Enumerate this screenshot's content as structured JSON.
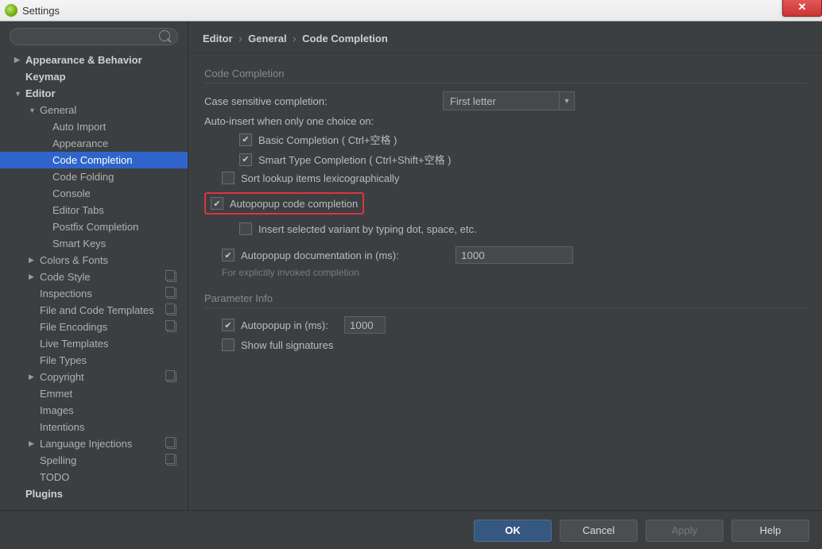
{
  "window": {
    "title": "Settings"
  },
  "search": {
    "placeholder": ""
  },
  "sidebar": {
    "items": [
      {
        "label": "Appearance & Behavior",
        "level": 0,
        "bold": true,
        "arrow": "▶"
      },
      {
        "label": "Keymap",
        "level": 0,
        "bold": true,
        "arrow": ""
      },
      {
        "label": "Editor",
        "level": 0,
        "bold": true,
        "arrow": "▼"
      },
      {
        "label": "General",
        "level": 1,
        "bold": false,
        "arrow": "▼"
      },
      {
        "label": "Auto Import",
        "level": 2,
        "bold": false,
        "arrow": ""
      },
      {
        "label": "Appearance",
        "level": 2,
        "bold": false,
        "arrow": ""
      },
      {
        "label": "Code Completion",
        "level": 2,
        "bold": false,
        "arrow": "",
        "selected": true
      },
      {
        "label": "Code Folding",
        "level": 2,
        "bold": false,
        "arrow": ""
      },
      {
        "label": "Console",
        "level": 2,
        "bold": false,
        "arrow": ""
      },
      {
        "label": "Editor Tabs",
        "level": 2,
        "bold": false,
        "arrow": ""
      },
      {
        "label": "Postfix Completion",
        "level": 2,
        "bold": false,
        "arrow": ""
      },
      {
        "label": "Smart Keys",
        "level": 2,
        "bold": false,
        "arrow": ""
      },
      {
        "label": "Colors & Fonts",
        "level": 1,
        "bold": false,
        "arrow": "▶"
      },
      {
        "label": "Code Style",
        "level": 1,
        "bold": false,
        "arrow": "▶",
        "copy": true
      },
      {
        "label": "Inspections",
        "level": 1,
        "bold": false,
        "arrow": "",
        "copy": true
      },
      {
        "label": "File and Code Templates",
        "level": 1,
        "bold": false,
        "arrow": "",
        "copy": true
      },
      {
        "label": "File Encodings",
        "level": 1,
        "bold": false,
        "arrow": "",
        "copy": true
      },
      {
        "label": "Live Templates",
        "level": 1,
        "bold": false,
        "arrow": ""
      },
      {
        "label": "File Types",
        "level": 1,
        "bold": false,
        "arrow": ""
      },
      {
        "label": "Copyright",
        "level": 1,
        "bold": false,
        "arrow": "▶",
        "copy": true
      },
      {
        "label": "Emmet",
        "level": 1,
        "bold": false,
        "arrow": ""
      },
      {
        "label": "Images",
        "level": 1,
        "bold": false,
        "arrow": ""
      },
      {
        "label": "Intentions",
        "level": 1,
        "bold": false,
        "arrow": ""
      },
      {
        "label": "Language Injections",
        "level": 1,
        "bold": false,
        "arrow": "▶",
        "copy": true
      },
      {
        "label": "Spelling",
        "level": 1,
        "bold": false,
        "arrow": "",
        "copy": true
      },
      {
        "label": "TODO",
        "level": 1,
        "bold": false,
        "arrow": ""
      },
      {
        "label": "Plugins",
        "level": 0,
        "bold": true,
        "arrow": ""
      }
    ]
  },
  "breadcrumb": {
    "a": "Editor",
    "b": "General",
    "c": "Code Completion",
    "sep": "›"
  },
  "sections": {
    "code_completion": "Code Completion",
    "parameter_info": "Parameter Info"
  },
  "fields": {
    "case_label": "Case sensitive completion:",
    "case_value": "First letter",
    "auto_insert_label": "Auto-insert when only one choice on:",
    "basic": "Basic Completion ( Ctrl+空格 )",
    "smart": "Smart Type Completion ( Ctrl+Shift+空格 )",
    "sort": "Sort lookup items lexicographically",
    "autopopup_code": "Autopopup code completion",
    "insert_selected": "Insert selected variant by typing dot, space, etc.",
    "autopopup_doc": "Autopopup documentation in (ms):",
    "autopopup_doc_hint": "For explicitly invoked completion",
    "autopopup_doc_value": "1000",
    "autopopup_in": "Autopopup in (ms):",
    "autopopup_in_value": "1000",
    "show_full": "Show full signatures"
  },
  "buttons": {
    "ok": "OK",
    "cancel": "Cancel",
    "apply": "Apply",
    "help": "Help"
  }
}
